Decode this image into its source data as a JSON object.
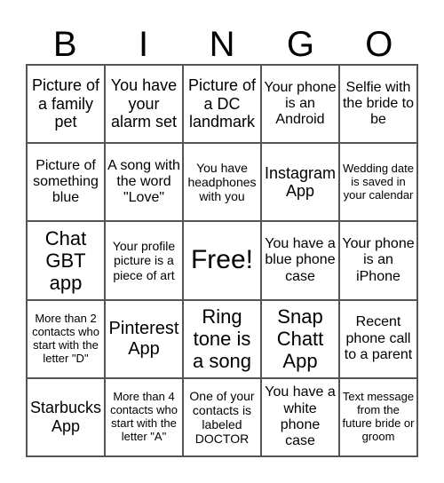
{
  "header": {
    "letters": [
      "B",
      "I",
      "N",
      "G",
      "O"
    ]
  },
  "cells": [
    "Picture of a family pet",
    "You have your alarm set",
    "Picture of a DC landmark",
    "Your phone is an Android",
    "Selfie with the bride to be",
    "Picture of something blue",
    "A song with the word \"Love\"",
    "You have headphones with you",
    "Instagram App",
    "Wedding date is saved in your calendar",
    "Chat GBT app",
    "Your profile picture is a piece of art",
    "Free!",
    "You have a blue phone case",
    "Your phone is an iPhone",
    "More than 2 contacts who start with the letter \"D\"",
    "Pinterest App",
    "Ring tone is a song",
    "Snap Chatt App",
    "Recent phone call to a parent",
    "Starbucks App",
    "More than 4 contacts who start with the letter \"A\"",
    "One of your contacts is labeled DOCTOR",
    "You have a white phone case",
    "Text message from the future bride or groom"
  ]
}
